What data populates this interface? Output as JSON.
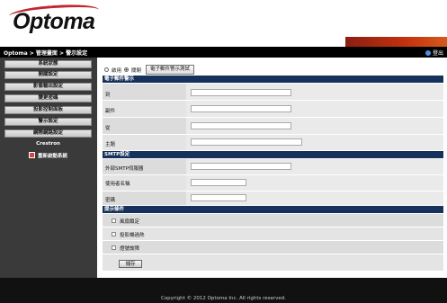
{
  "header": {
    "logo_text": "Optoma",
    "breadcrumb": "Optoma > 管理畫面 > 警示設定",
    "logout_label": "登出",
    "brand_color": "#c4262e"
  },
  "sidebar": {
    "items": [
      {
        "label": "系統狀態"
      },
      {
        "label": "開關設定"
      },
      {
        "label": "影像輸出設定"
      },
      {
        "label": "變更密碼"
      },
      {
        "label": "投影控制面板"
      },
      {
        "label": "警示設定"
      },
      {
        "label": "網際網路設定"
      },
      {
        "label": "Crestron"
      },
      {
        "label": "重新啟動系統"
      }
    ]
  },
  "main": {
    "radio": {
      "options": [
        "啟用",
        "關閉"
      ],
      "selected": "關閉"
    },
    "test_button": "電子郵件警示測試",
    "email_section": {
      "title": "電子郵件警示",
      "fields": [
        {
          "label": "到",
          "value": ""
        },
        {
          "label": "副件",
          "value": ""
        },
        {
          "label": "從",
          "value": ""
        },
        {
          "label": "主題",
          "value": ""
        }
      ]
    },
    "smtp_section": {
      "title": "SMTP設定",
      "fields": [
        {
          "label": "外部SMTP伺服器",
          "value": ""
        },
        {
          "label": "使用者名稱",
          "value": ""
        },
        {
          "label": "密碼",
          "value": ""
        }
      ]
    },
    "alert_section": {
      "title": "提示條件",
      "conditions": [
        {
          "label": "風扇鎖定",
          "checked": false
        },
        {
          "label": "投影機過熱",
          "checked": false
        },
        {
          "label": "燈號故障",
          "checked": false
        }
      ]
    },
    "save_button": "儲存"
  },
  "footer": {
    "copyright": "Copyright © 2012 Optoma Inc. All rights reserved."
  }
}
